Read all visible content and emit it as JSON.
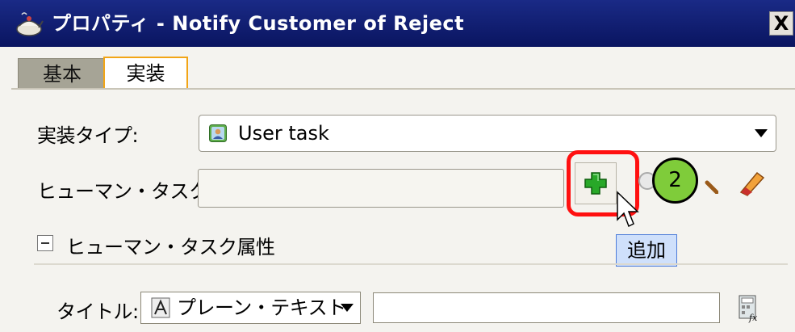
{
  "window": {
    "title": "プロパティ - Notify Customer of Reject",
    "close_glyph": "X",
    "icon": "teapot-icon"
  },
  "tabs": [
    {
      "label": "基本",
      "selected": false
    },
    {
      "label": "実装",
      "selected": true
    }
  ],
  "implementation_type": {
    "label": "実装タイプ:",
    "value": "User task",
    "icon": "user-task-icon"
  },
  "human_task": {
    "label": "ヒューマン・タスク:",
    "value": "",
    "add_tooltip": "追加"
  },
  "step_marker": "2",
  "human_task_attributes": {
    "section_label": "ヒューマン・タスク属性",
    "title_label": "タイトル:",
    "title_format": "プレーン・テキスト",
    "title_value": ""
  },
  "colors": {
    "titlebar": "#0e1a6e",
    "highlight": "#ff1010",
    "step_badge": "#7fcc3a",
    "tab_selected_border": "#f2a516",
    "tooltip_bg": "#cfe0fb"
  }
}
